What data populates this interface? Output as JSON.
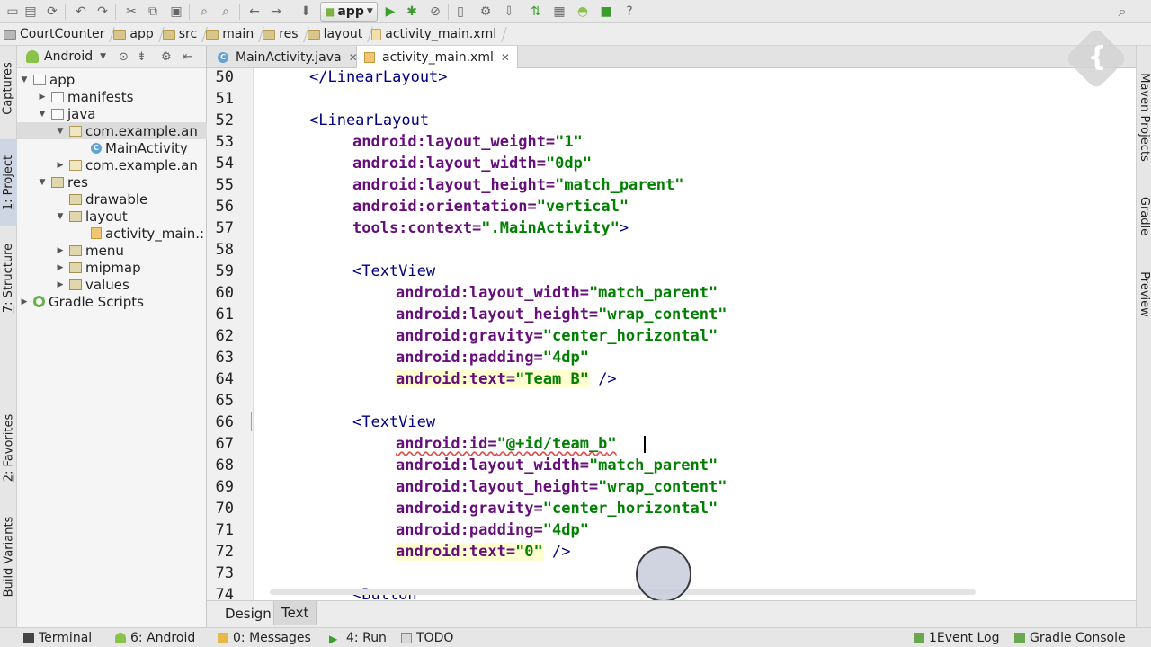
{
  "toolbar": {
    "run_config": "app",
    "icons": [
      "open-icon",
      "save-icon",
      "sync-icon",
      "undo-icon",
      "redo-icon",
      "cut-icon",
      "copy-icon",
      "paste-icon",
      "find-icon",
      "replace-icon",
      "back-icon",
      "forward-icon",
      "make-icon",
      "run-icon",
      "debug-icon",
      "attach-debugger-icon",
      "avd-manager-icon",
      "sdk-manager-icon",
      "gradle-sync-icon",
      "device-monitor-icon",
      "android-icon",
      "help-icon",
      "search-everywhere-icon"
    ]
  },
  "breadcrumb": [
    "CourtCounter",
    "app",
    "src",
    "main",
    "res",
    "layout",
    "activity_main.xml"
  ],
  "left_strip": {
    "captures": "Captures",
    "project_num": "1",
    "project": ": Project",
    "structure_num": "7",
    "structure": ": Structure",
    "favorites_num": "2",
    "favorites": ": Favorites",
    "build_variants": "Build Variants"
  },
  "project_panel": {
    "view_name": "Android",
    "tree": [
      {
        "label": "app",
        "expanded": true
      },
      {
        "label": "manifests",
        "expanded": false
      },
      {
        "label": "java",
        "expanded": true
      },
      {
        "label": "com.example.an",
        "expanded": true
      },
      {
        "label": "MainActivity"
      },
      {
        "label": "com.example.an",
        "expanded": false
      },
      {
        "label": "res",
        "expanded": true
      },
      {
        "label": "drawable"
      },
      {
        "label": "layout",
        "expanded": true
      },
      {
        "label": "activity_main.:"
      },
      {
        "label": "menu",
        "expanded": false
      },
      {
        "label": "mipmap",
        "expanded": false
      },
      {
        "label": "values",
        "expanded": false
      },
      {
        "label": "Gradle Scripts",
        "expanded": false
      }
    ]
  },
  "editor_tabs": [
    {
      "label": "MainActivity.java",
      "active": false
    },
    {
      "label": "activity_main.xml",
      "active": true
    }
  ],
  "editor": {
    "line_numbers": [
      "50",
      "51",
      "52",
      "53",
      "54",
      "55",
      "56",
      "57",
      "58",
      "59",
      "60",
      "61",
      "62",
      "63",
      "64",
      "65",
      "66",
      "67",
      "68",
      "69",
      "70",
      "71",
      "72",
      "73",
      "74"
    ],
    "code": {
      "l50_tag": "</LinearLayout>",
      "l52_tag": "<LinearLayout",
      "l53_attr": "android:layout_weight=",
      "l53_val": "\"1\"",
      "l54_attr": "android:layout_width=",
      "l54_val": "\"0dp\"",
      "l55_attr": "android:layout_height=",
      "l55_val": "\"match_parent\"",
      "l56_attr": "android:orientation=",
      "l56_val": "\"vertical\"",
      "l57_attr": "tools:context=",
      "l57_val": "\".MainActivity\"",
      "l57_end": ">",
      "l59_tag": "<TextView",
      "l60_attr": "android:layout_width=",
      "l60_val": "\"match_parent\"",
      "l61_attr": "android:layout_height=",
      "l61_val": "\"wrap_content\"",
      "l62_attr": "android:gravity=",
      "l62_val": "\"center_horizontal\"",
      "l63_attr": "android:padding=",
      "l63_val": "\"4dp\"",
      "l64_attr": "android:text=",
      "l64_val": "\"Team B\"",
      "l64_end": " />",
      "l66_tag": "<TextView",
      "l67_attr": "android:id=",
      "l67_val_a": "\"@+id/team_b",
      "l67_val_b": "\"",
      "l68_attr": "android:layout_width=",
      "l68_val": "\"match_parent\"",
      "l69_attr": "android:layout_height=",
      "l69_val": "\"wrap_content\"",
      "l70_attr": "android:gravity=",
      "l70_val": "\"center_horizontal\"",
      "l71_attr": "android:padding=",
      "l71_val": "\"4dp\"",
      "l72_attr": "android:text=",
      "l72_val": "\"0\"",
      "l72_end": " />",
      "l74_tag": "<Button"
    }
  },
  "right_strip": {
    "maven": "Maven Projects",
    "gradle": "Gradle",
    "preview": "Preview"
  },
  "logo_glyph": "{",
  "view_tabs": {
    "design": "Design",
    "text": "Text",
    "active": "Text"
  },
  "statusbar": {
    "terminal": "Terminal",
    "android_num": "6",
    "android": ": Android",
    "messages_num": "0",
    "messages": ": Messages",
    "run_num": "4",
    "run": ": Run",
    "todo": "TODO",
    "event_log_num": "1",
    "event_log": " Event Log",
    "gradle_console": "Gradle Console"
  },
  "colors": {
    "xml_tag": "#000080",
    "xml_attr": "#660e7a",
    "xml_value": "#008000",
    "android_green": "#8bc34a"
  }
}
